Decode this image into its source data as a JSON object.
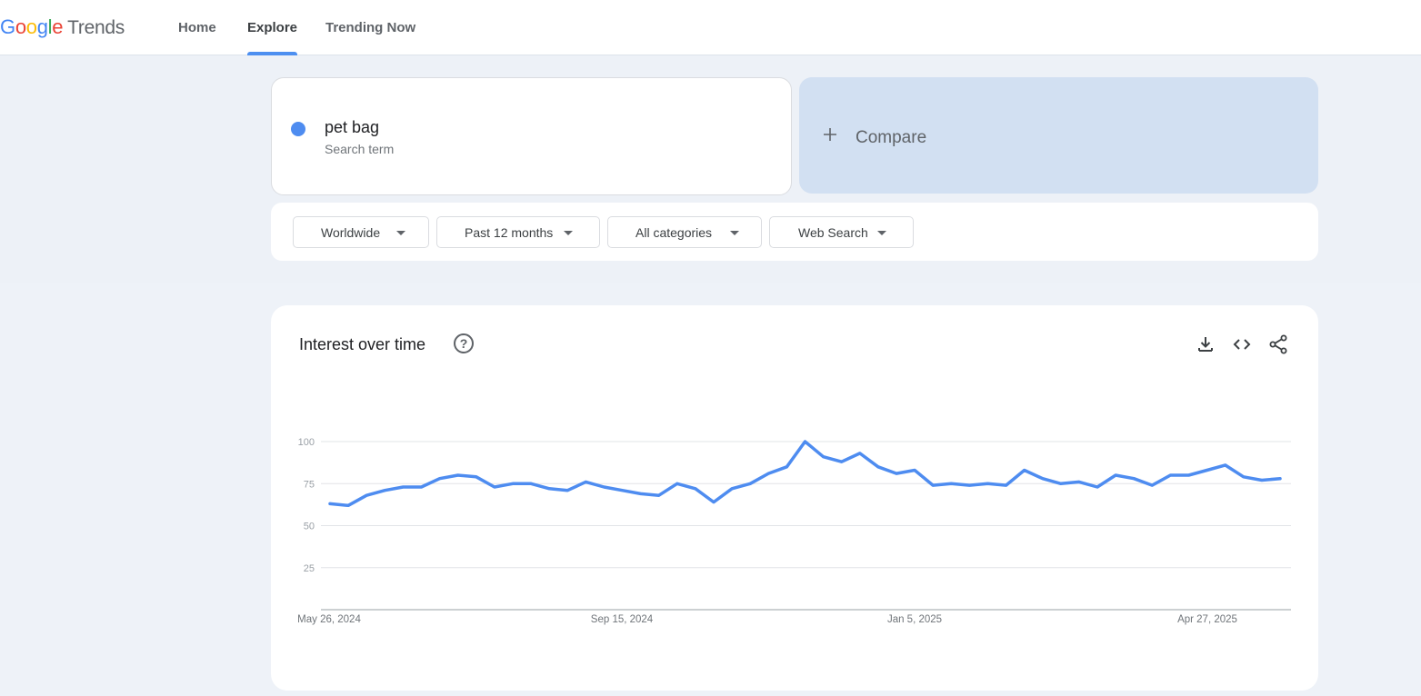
{
  "header": {
    "logo_google": "Google",
    "logo_trends": "Trends",
    "nav": [
      {
        "label": "Home",
        "active": false
      },
      {
        "label": "Explore",
        "active": true
      },
      {
        "label": "Trending Now",
        "active": false
      }
    ]
  },
  "term": {
    "name": "pet bag",
    "type": "Search term",
    "color": "#4e8cf0"
  },
  "compare": {
    "label": "Compare"
  },
  "filters": [
    {
      "label": "Worldwide"
    },
    {
      "label": "Past 12 months"
    },
    {
      "label": "All categories"
    },
    {
      "label": "Web Search"
    }
  ],
  "chart_card": {
    "title": "Interest over time",
    "icons": [
      "help-icon",
      "download-icon",
      "embed-code-icon",
      "share-icon"
    ]
  },
  "chart_data": {
    "type": "line",
    "title": "Interest over time",
    "ylim": [
      0,
      100
    ],
    "y_ticks": [
      "25",
      "50",
      "75",
      "100"
    ],
    "x_tick_labels": [
      "May 26, 2024",
      "Sep 15, 2024",
      "Jan 5, 2025",
      "Apr 27, 2025"
    ],
    "grid": true,
    "series": [
      {
        "color": "#4e8cf0",
        "values": [
          63,
          62,
          68,
          71,
          73,
          73,
          78,
          80,
          79,
          73,
          75,
          75,
          72,
          71,
          76,
          73,
          71,
          69,
          68,
          75,
          72,
          64,
          72,
          75,
          81,
          85,
          100,
          91,
          88,
          93,
          85,
          81,
          83,
          74,
          75,
          74,
          75,
          74,
          83,
          78,
          75,
          76,
          73,
          80,
          78,
          74,
          80,
          80,
          83,
          86,
          79,
          77,
          78
        ]
      }
    ]
  }
}
